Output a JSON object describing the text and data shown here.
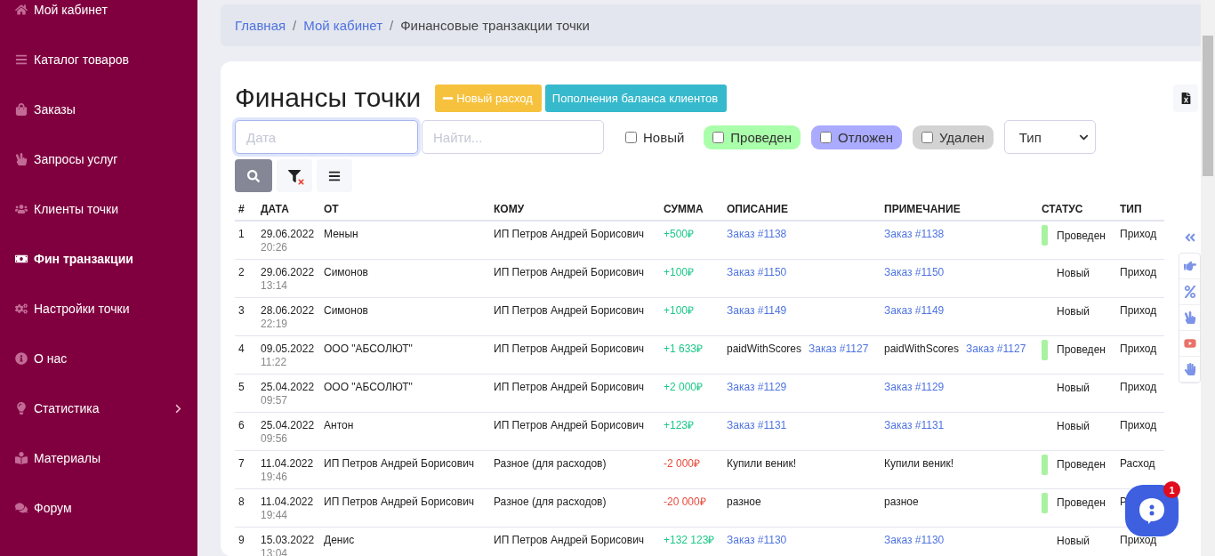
{
  "sidebar": {
    "items": [
      {
        "label": "Мой кабинет",
        "kind": "home",
        "selected": false
      },
      {
        "label": "Каталог товаров",
        "kind": "list",
        "selected": false
      },
      {
        "label": "Заказы",
        "kind": "bag",
        "selected": false
      },
      {
        "label": "Запросы услуг",
        "kind": "peace",
        "selected": false
      },
      {
        "label": "Клиенты точки",
        "kind": "users",
        "selected": false
      },
      {
        "label": "Фин транзакции",
        "kind": "money",
        "selected": true
      },
      {
        "label": "Настройки точки",
        "kind": "cogs",
        "selected": false
      },
      {
        "label": "О нас",
        "kind": "info",
        "selected": false
      },
      {
        "label": "Статистика",
        "kind": "bulb",
        "selected": false,
        "has_submenu": true
      },
      {
        "label": "Материалы",
        "kind": "reader",
        "selected": false
      },
      {
        "label": "Форум",
        "kind": "comments",
        "selected": false
      }
    ]
  },
  "breadcrumb_separator": "/",
  "breadcrumbs": [
    {
      "label": "Главная",
      "link": true
    },
    {
      "label": "Мой кабинет",
      "link": true
    },
    {
      "label": "Финансовые транзакции точки",
      "link": false
    }
  ],
  "page_title": "Финансы точки",
  "actions": [
    {
      "label": "Новый расход",
      "kind": "warning"
    },
    {
      "label": "Пополнения баланса клиентов",
      "kind": "info"
    }
  ],
  "filters": {
    "date": {
      "placeholder": "Дата"
    },
    "search": {
      "placeholder": "Найти..."
    },
    "statuses": [
      {
        "label": "Новый",
        "checked": false
      },
      {
        "label": "Проведен",
        "checked": false,
        "color": "#aaffaa"
      },
      {
        "label": "Отложен",
        "checked": false,
        "color": "#aaaaff"
      },
      {
        "label": "Удален",
        "checked": false,
        "color": "#d3d3d3"
      }
    ],
    "type_select": "Тип"
  },
  "table": {
    "columns": [
      "#",
      "ДАТА",
      "ОТ",
      "КОМУ",
      "СУММА",
      "ОПИСАНИЕ",
      "ПРИМЕЧАНИЕ",
      "СТАТУС",
      "ТИП"
    ],
    "rows": [
      {
        "n": "1",
        "date": "29.06.2022",
        "time": "20:26",
        "from": "Менын",
        "to": "ИП Петров Андрей Борисович",
        "amount": "+500₽",
        "kind": "income",
        "description": [
          {
            "text": "Заказ #1138",
            "link": true
          }
        ],
        "note": [
          {
            "text": "Заказ #1138",
            "link": true
          }
        ],
        "status": "Проведен",
        "confirmed": true,
        "type": "Приход"
      },
      {
        "n": "2",
        "date": "29.06.2022",
        "time": "13:14",
        "from": "Симонов",
        "to": "ИП Петров Андрей Борисович",
        "amount": "+100₽",
        "kind": "income",
        "description": [
          {
            "text": "Заказ #1150",
            "link": true
          }
        ],
        "note": [
          {
            "text": "Заказ #1150",
            "link": true
          }
        ],
        "status": "Новый",
        "confirmed": false,
        "type": "Приход"
      },
      {
        "n": "3",
        "date": "28.06.2022",
        "time": "22:19",
        "from": "Симонов",
        "to": "ИП Петров Андрей Борисович",
        "amount": "+100₽",
        "kind": "income",
        "description": [
          {
            "text": "Заказ #1149",
            "link": true
          }
        ],
        "note": [
          {
            "text": "Заказ #1149",
            "link": true
          }
        ],
        "status": "Новый",
        "confirmed": false,
        "type": "Приход"
      },
      {
        "n": "4",
        "date": "09.05.2022",
        "time": "11:22",
        "from": "ООО \"АБСОЛЮТ\"",
        "to": "ИП Петров Андрей Борисович",
        "amount": "+1 633₽",
        "kind": "income",
        "description": [
          {
            "text": "paidWithScores",
            "link": false
          },
          {
            "text": "Заказ #1127",
            "link": true
          }
        ],
        "note": [
          {
            "text": "paidWithScores",
            "link": false
          },
          {
            "text": "Заказ #1127",
            "link": true
          }
        ],
        "status": "Проведен",
        "confirmed": true,
        "type": "Приход"
      },
      {
        "n": "5",
        "date": "25.04.2022",
        "time": "09:57",
        "from": "ООО \"АБСОЛЮТ\"",
        "to": "ИП Петров Андрей Борисович",
        "amount": "+2 000₽",
        "kind": "income",
        "description": [
          {
            "text": "Заказ #1129",
            "link": true
          }
        ],
        "note": [
          {
            "text": "Заказ #1129",
            "link": true
          }
        ],
        "status": "Новый",
        "confirmed": false,
        "type": "Приход"
      },
      {
        "n": "6",
        "date": "25.04.2022",
        "time": "09:56",
        "from": "Антон",
        "to": "ИП Петров Андрей Борисович",
        "amount": "+123₽",
        "kind": "income",
        "description": [
          {
            "text": "Заказ #1131",
            "link": true
          }
        ],
        "note": [
          {
            "text": "Заказ #1131",
            "link": true
          }
        ],
        "status": "Новый",
        "confirmed": false,
        "type": "Приход"
      },
      {
        "n": "7",
        "date": "11.04.2022",
        "time": "19:46",
        "from": "ИП Петров Андрей Борисович",
        "to": "Разное (для расходов)",
        "amount": "-2 000₽",
        "kind": "expense",
        "description": [
          {
            "text": "Купили веник!",
            "link": false
          }
        ],
        "note": [
          {
            "text": "Купили веник!",
            "link": false
          }
        ],
        "status": "Проведен",
        "confirmed": true,
        "type": "Расход"
      },
      {
        "n": "8",
        "date": "11.04.2022",
        "time": "19:44",
        "from": "ИП Петров Андрей Борисович",
        "to": "Разное (для расходов)",
        "amount": "-20 000₽",
        "kind": "expense",
        "description": [
          {
            "text": "разное",
            "link": false
          }
        ],
        "note": [
          {
            "text": "разное",
            "link": false
          }
        ],
        "status": "Проведен",
        "confirmed": true,
        "type": "Р"
      },
      {
        "n": "9",
        "date": "15.03.2022",
        "time": "13:04",
        "from": "Денис",
        "to": "ИП Петров Андрей Борисович",
        "amount": "+132 123₽",
        "kind": "income",
        "description": [
          {
            "text": "Заказ #1130",
            "link": true
          }
        ],
        "note": [
          {
            "text": "Заказ #1130",
            "link": true
          }
        ],
        "status": "Новый",
        "confirmed": false,
        "type": "Приход"
      }
    ]
  },
  "chat": {
    "badge": "1"
  }
}
